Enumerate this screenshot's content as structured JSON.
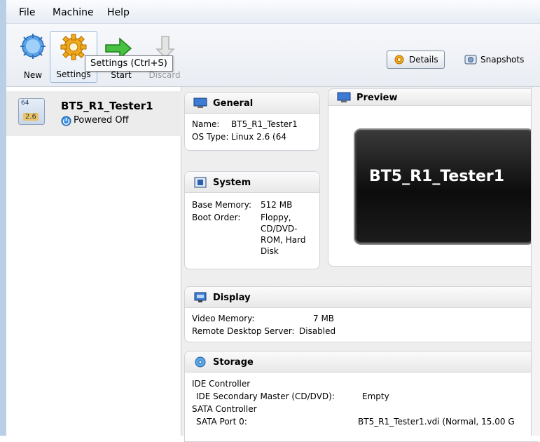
{
  "menu": {
    "file": "File",
    "machine": "Machine",
    "help": "Help"
  },
  "toolbar": {
    "new_label": "New",
    "settings_label": "Settings",
    "start_label": "Start",
    "discard_label": "Discard",
    "tooltip": "Settings (Ctrl+S)",
    "details_label": "Details",
    "snapshots_label": "Snapshots"
  },
  "vm": {
    "badge_top": "64",
    "badge_version": "2.6",
    "name": "BT5_R1_Tester1",
    "state": "Powered Off"
  },
  "general": {
    "title": "General",
    "name_label": "Name:",
    "name_value": "BT5_R1_Tester1",
    "os_label": "OS Type:",
    "os_value": "Linux 2.6 (64"
  },
  "system": {
    "title": "System",
    "memory_label": "Base Memory:",
    "memory_value": "512 MB",
    "boot_label": "Boot Order:",
    "boot_lines": [
      "Floppy,",
      "CD/DVD-",
      "ROM, Hard",
      "Disk"
    ]
  },
  "preview": {
    "title": "Preview",
    "screen_text": "BT5_R1_Tester1"
  },
  "display": {
    "title": "Display",
    "video_label": "Video Memory:",
    "video_value": "7 MB",
    "rds_label": "Remote Desktop Server:",
    "rds_value": "Disabled"
  },
  "storage": {
    "title": "Storage",
    "ide_controller": "IDE Controller",
    "ide_secondary": "IDE Secondary Master (CD/DVD):",
    "ide_secondary_value": "Empty",
    "sata_controller": "SATA Controller",
    "sata_port": "SATA Port 0:",
    "sata_port_value": "BT5_R1_Tester1.vdi (Normal, 15.00 G"
  },
  "colors": {
    "frame": "#b9cfe6",
    "selection": "#ececec",
    "preview_bg": "#0c0c0c"
  },
  "icons": [
    "new-icon",
    "settings-gear-icon",
    "start-arrow-icon",
    "discard-arrow-icon",
    "details-gear-icon",
    "snapshots-camera-icon",
    "vm-os-icon",
    "powered-off-icon",
    "monitor-icon",
    "chip-icon",
    "display-icon",
    "disk-icon"
  ]
}
